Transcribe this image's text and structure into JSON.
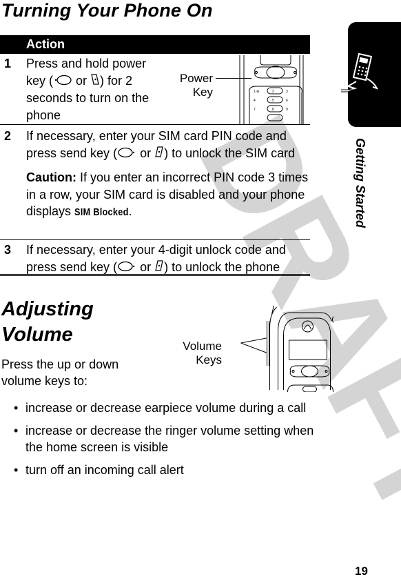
{
  "watermark": "DRAFT",
  "section1": {
    "title": "Turning Your Phone On",
    "table_header": "Action",
    "steps": [
      {
        "number": "1",
        "text_before": "Press and hold power key (",
        "text_or": " or ",
        "text_after": ") for 2 seconds to turn on the phone",
        "icons": [
          "power-key-icon",
          "power-key-alt-icon"
        ]
      },
      {
        "number": "2",
        "text_before": "If necessary, enter your SIM card PIN code and press send key (",
        "text_or": " or ",
        "text_after": ") to unlock the SIM card",
        "caution_label": "Caution:",
        "caution_text": " If you enter an incorrect PIN code 3 times in a row, your SIM card is disabled and your phone displays ",
        "caution_display": "SIM Blocked",
        "caution_end": ".",
        "icons": [
          "send-key-icon",
          "send-key-alt-icon"
        ]
      },
      {
        "number": "3",
        "text_before": "If necessary, enter your 4-digit unlock code and press send key (",
        "text_or": " or ",
        "text_after": ") to unlock the phone",
        "icons": [
          "send-key-icon",
          "send-key-alt-icon"
        ]
      }
    ],
    "figure_label_line1": "Power",
    "figure_label_line2": "Key"
  },
  "section2": {
    "title_line1": "Adjusting",
    "title_line2": "Volume",
    "intro_line1": "Press the up or down",
    "intro_line2": "volume keys to:",
    "figure_label_line1": "Volume",
    "figure_label_line2": "Keys",
    "bullets": [
      "increase or decrease earpiece volume during a call",
      "increase or decrease the ringer volume setting when the home screen is visible",
      "turn off an incoming call alert"
    ],
    "bullet_glyph": "•"
  },
  "side_tab": {
    "icon": "running-phone-icon",
    "label": "Getting Started"
  },
  "page_number": "19"
}
